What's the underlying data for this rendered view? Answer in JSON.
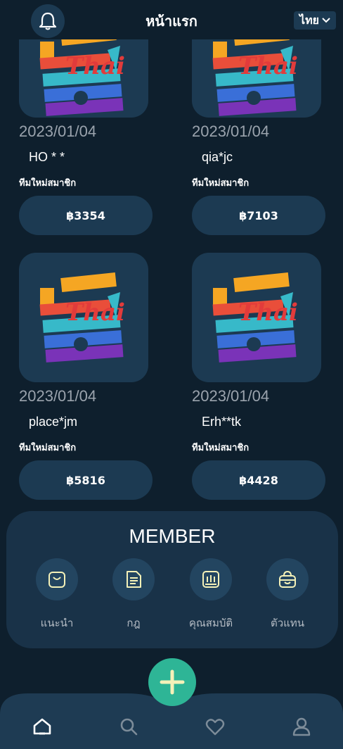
{
  "header": {
    "title": "หน้าแรก",
    "language": "ไทย",
    "bell_icon": "bell-icon"
  },
  "cards": [
    {
      "date": "2023/01/04",
      "user": "HO * *",
      "team": "ทีมใหม่สมาชิก",
      "amount": "฿3354"
    },
    {
      "date": "2023/01/04",
      "user": "qia*jc",
      "team": "ทีมใหม่สมาชิก",
      "amount": "฿7103"
    },
    {
      "date": "2023/01/04",
      "user": "place*jm",
      "team": "ทีมใหม่สมาชิก",
      "amount": "฿5816"
    },
    {
      "date": "2023/01/04",
      "user": "Erh**tk",
      "team": "ทีมใหม่สมาชิก",
      "amount": "฿4428"
    }
  ],
  "member": {
    "title": "MEMBER",
    "items": [
      {
        "label": "แนะนำ",
        "icon": "bag-icon"
      },
      {
        "label": "กฎ",
        "icon": "document-icon"
      },
      {
        "label": "คุณสมบัติ",
        "icon": "chart-icon"
      },
      {
        "label": "ตัวแทน",
        "icon": "shopping-bag-icon"
      }
    ]
  },
  "bottom_nav": {
    "items": [
      {
        "icon": "home-icon"
      },
      {
        "icon": "search-icon"
      },
      {
        "icon": "heart-icon"
      },
      {
        "icon": "user-icon"
      }
    ],
    "fab_icon": "plus-icon"
  },
  "colors": {
    "background": "#0e1f2d",
    "card": "#1c3a52",
    "panel": "#193248",
    "accent": "#2eb596",
    "icon_stroke": "#f4f1b8"
  }
}
